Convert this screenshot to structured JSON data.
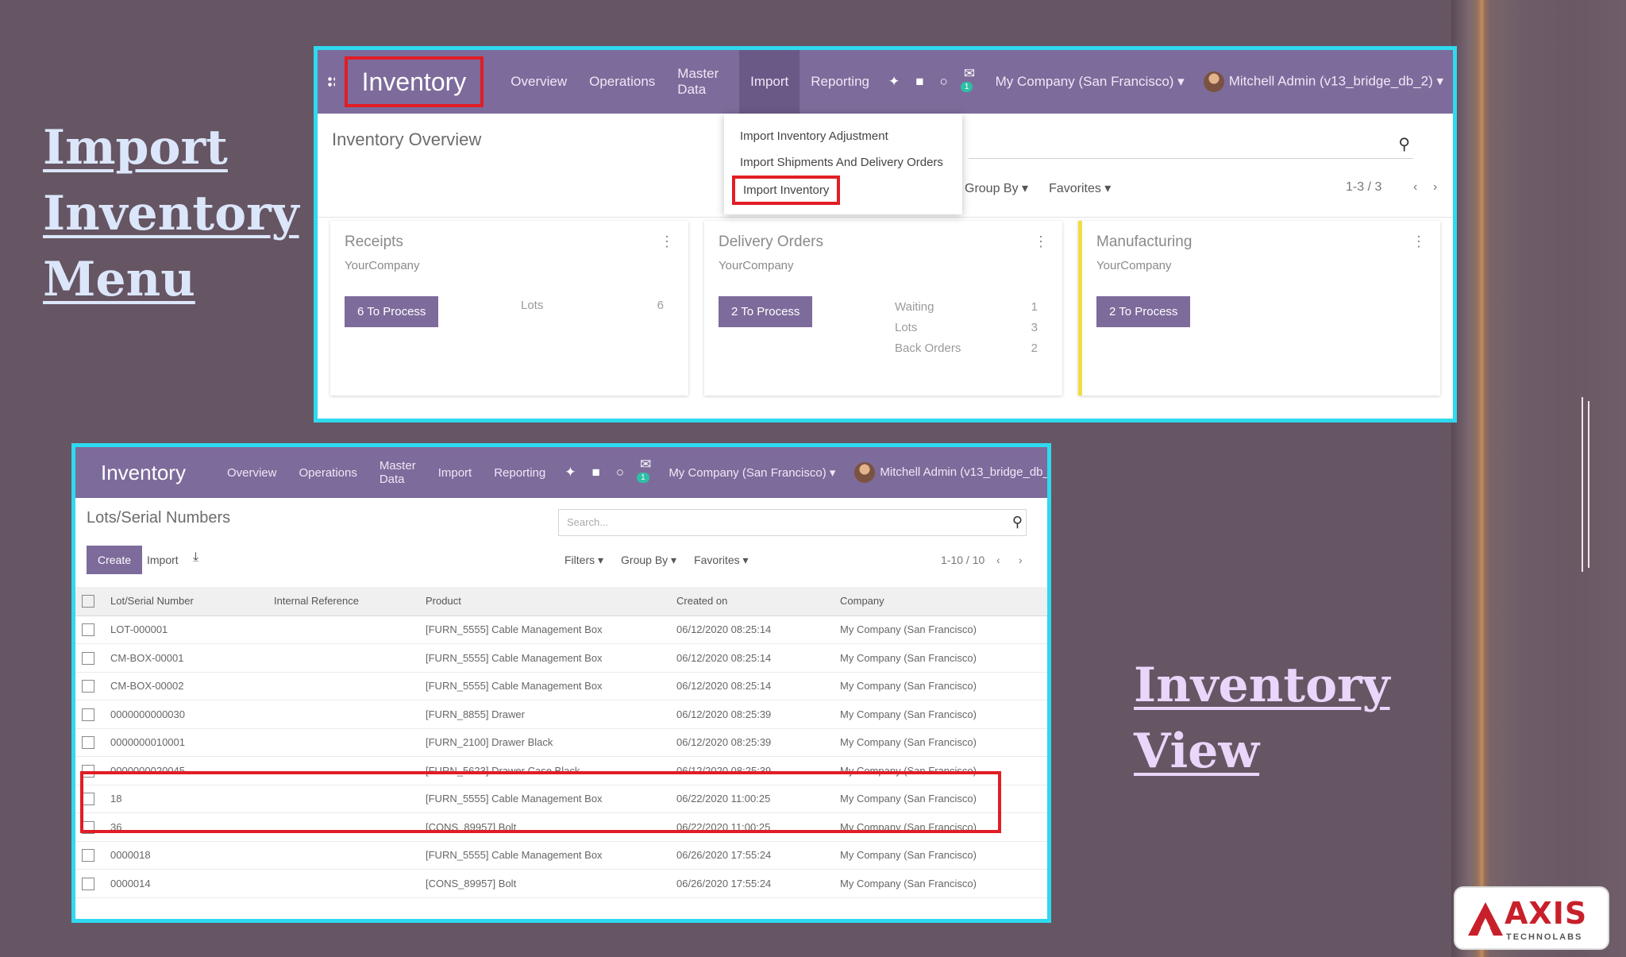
{
  "headings": {
    "left": [
      "Import",
      "Inventory",
      "Menu"
    ],
    "right": [
      "Inventory",
      "View"
    ]
  },
  "app_brand": "Inventory",
  "nav_items": [
    "Overview",
    "Operations",
    "Master Data",
    "Import",
    "Reporting"
  ],
  "nav_badge": "1",
  "company": "My Company (San Francisco) ▾",
  "user": "Mitchell Admin (v13_bridge_db_2) ▾",
  "overview": {
    "breadcrumb": "Inventory Overview",
    "group_by": "Group By ▾",
    "favorites": "Favorites ▾",
    "pager": "1-3 / 3",
    "import_menu": [
      "Import Inventory Adjustment",
      "Import Shipments And Delivery Orders",
      "Import Inventory"
    ],
    "cards": [
      {
        "title": "Receipts",
        "company": "YourCompany",
        "button": "6 To Process",
        "stats": [
          [
            "Lots",
            "6"
          ]
        ]
      },
      {
        "title": "Delivery Orders",
        "company": "YourCompany",
        "button": "2 To Process",
        "stats": [
          [
            "Waiting",
            "1"
          ],
          [
            "Lots",
            "3"
          ],
          [
            "Back Orders",
            "2"
          ]
        ]
      },
      {
        "title": "Manufacturing",
        "company": "YourCompany",
        "button": "2 To Process",
        "stats": []
      }
    ]
  },
  "lots": {
    "breadcrumb": "Lots/Serial Numbers",
    "create": "Create",
    "import": "Import",
    "search_placeholder": "Search...",
    "filters": "Filters ▾",
    "group_by": "Group By ▾",
    "favorites": "Favorites ▾",
    "pager": "1-10 / 10",
    "columns": [
      "Lot/Serial Number",
      "Internal Reference",
      "Product",
      "Created on",
      "Company"
    ],
    "rows": [
      [
        "LOT-000001",
        "",
        "[FURN_5555] Cable Management Box",
        "06/12/2020 08:25:14",
        "My Company (San Francisco)"
      ],
      [
        "CM-BOX-00001",
        "",
        "[FURN_5555] Cable Management Box",
        "06/12/2020 08:25:14",
        "My Company (San Francisco)"
      ],
      [
        "CM-BOX-00002",
        "",
        "[FURN_5555] Cable Management Box",
        "06/12/2020 08:25:14",
        "My Company (San Francisco)"
      ],
      [
        "0000000000030",
        "",
        "[FURN_8855] Drawer",
        "06/12/2020 08:25:39",
        "My Company (San Francisco)"
      ],
      [
        "0000000010001",
        "",
        "[FURN_2100] Drawer Black",
        "06/12/2020 08:25:39",
        "My Company (San Francisco)"
      ],
      [
        "0000000020045",
        "",
        "[FURN_5623] Drawer Case Black",
        "06/12/2020 08:25:39",
        "My Company (San Francisco)"
      ],
      [
        "18",
        "",
        "[FURN_5555] Cable Management Box",
        "06/22/2020 11:00:25",
        "My Company (San Francisco)"
      ],
      [
        "36",
        "",
        "[CONS_89957] Bolt",
        "06/22/2020 11:00:25",
        "My Company (San Francisco)"
      ],
      [
        "0000018",
        "",
        "[FURN_5555] Cable Management Box",
        "06/26/2020 17:55:24",
        "My Company (San Francisco)"
      ],
      [
        "0000014",
        "",
        "[CONS_89957] Bolt",
        "06/26/2020 17:55:24",
        "My Company (San Francisco)"
      ]
    ]
  },
  "logo": {
    "name": "AXIS",
    "tagline": "TECHNOLABS"
  },
  "colors": {
    "accent": "#7d6b9b",
    "highlight": "#e11d25",
    "frame": "#2fd9ee",
    "background": "#665563"
  }
}
